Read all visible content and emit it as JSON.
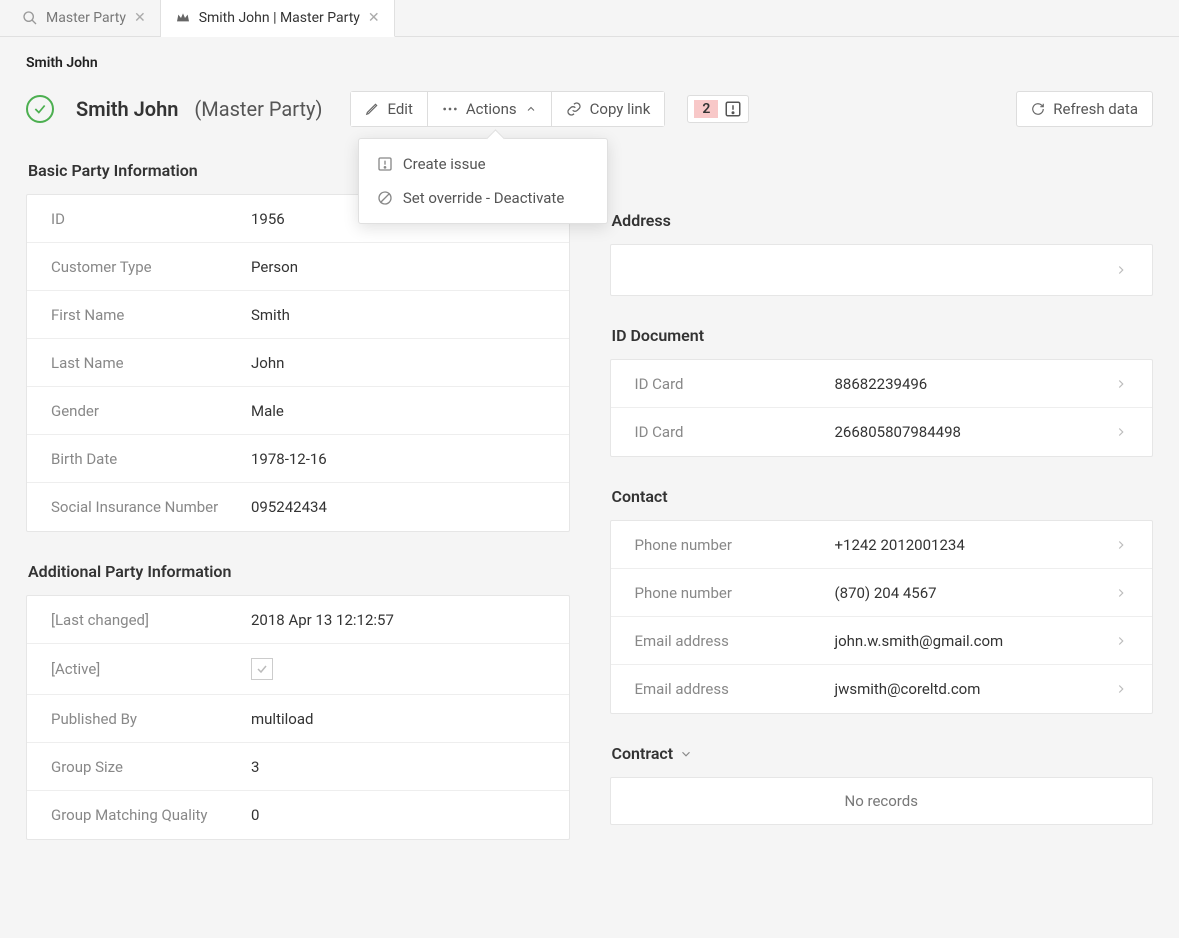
{
  "tabs": [
    {
      "label": "Master Party",
      "icon": "search-icon",
      "active": false
    },
    {
      "label": "Smith John  | Master Party",
      "icon": "crown-icon",
      "active": true
    }
  ],
  "breadcrumb": "Smith John",
  "header": {
    "name": "Smith John",
    "type": "(Master Party)",
    "edit": "Edit",
    "actions": "Actions",
    "copy_link": "Copy link",
    "issue_count": "2",
    "refresh": "Refresh data"
  },
  "actions_menu": {
    "create_issue": "Create issue",
    "set_override": "Set override - Deactivate"
  },
  "basic": {
    "title": "Basic Party Information",
    "rows": [
      {
        "label": "ID",
        "value": "1956"
      },
      {
        "label": "Customer Type",
        "value": "Person"
      },
      {
        "label": "First Name",
        "value": "Smith"
      },
      {
        "label": "Last Name",
        "value": "John"
      },
      {
        "label": "Gender",
        "value": "Male"
      },
      {
        "label": "Birth Date",
        "value": "1978-12-16"
      },
      {
        "label": "Social Insurance Number",
        "value": "095242434"
      }
    ]
  },
  "additional": {
    "title": "Additional Party Information",
    "rows": [
      {
        "label": "[Last changed]",
        "value": "2018 Apr 13 12:12:57"
      },
      {
        "label": "[Active]",
        "value": "__checkbox__"
      },
      {
        "label": "Published By",
        "value": "multiload"
      },
      {
        "label": "Group Size",
        "value": "3"
      },
      {
        "label": "Group Matching Quality",
        "value": "0"
      }
    ]
  },
  "address": {
    "title": "Address"
  },
  "id_document": {
    "title": "ID Document",
    "rows": [
      {
        "label": "ID Card",
        "value": "88682239496"
      },
      {
        "label": "ID Card",
        "value": "266805807984498"
      }
    ]
  },
  "contact": {
    "title": "Contact",
    "rows": [
      {
        "label": "Phone number",
        "value": "+1242 2012001234"
      },
      {
        "label": "Phone number",
        "value": "(870) 204 4567"
      },
      {
        "label": "Email address",
        "value": "john.w.smith@gmail.com"
      },
      {
        "label": "Email address",
        "value": "jwsmith@coreltd.com"
      }
    ]
  },
  "contract": {
    "title": "Contract",
    "no_records": "No records"
  }
}
